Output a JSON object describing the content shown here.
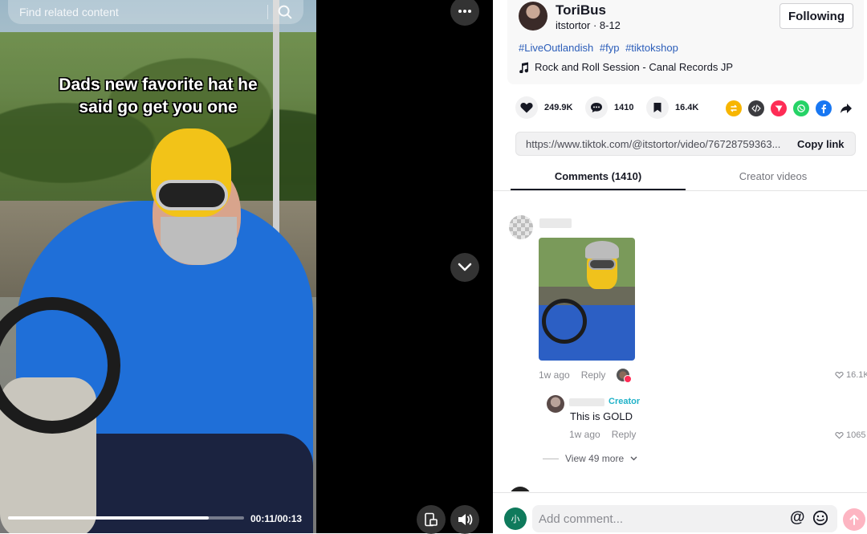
{
  "video": {
    "search_placeholder": "Find related content",
    "caption_line1": "Dads new favorite hat he",
    "caption_line2": "said go get you one",
    "timecode": "00:11/00:13",
    "progress": 0.85
  },
  "author": {
    "display_name": "ToriBus",
    "handle_date": "itstortor · 8-12",
    "follow_label": "Following",
    "hashtags": [
      "#LiveOutlandish",
      "#fyp",
      "#tiktokshop"
    ],
    "music": "Rock and Roll Session - Canal Records JP"
  },
  "stats": {
    "likes": "249.9K",
    "comments": "1410",
    "saves": "16.4K"
  },
  "share_icons": [
    {
      "name": "repost-icon",
      "color": "#f7b500"
    },
    {
      "name": "embed-icon",
      "color": "#3b3b3f"
    },
    {
      "name": "send-to-friends-icon",
      "color": "#fe2c55"
    },
    {
      "name": "whatsapp-icon",
      "color": "#25d366"
    },
    {
      "name": "facebook-icon",
      "color": "#1877f2"
    },
    {
      "name": "share-arrow-icon",
      "color": "#161823"
    }
  ],
  "link": {
    "url": "https://www.tiktok.com/@itstortor/video/76728759363...",
    "copy_label": "Copy link"
  },
  "tabs": {
    "comments": "Comments (1410)",
    "creator_videos": "Creator videos"
  },
  "comment": {
    "time": "1w ago",
    "reply_label": "Reply",
    "likes": "16.1K"
  },
  "reply": {
    "badge": "Creator",
    "text": "This is GOLD",
    "time": "1w ago",
    "reply_label": "Reply",
    "likes": "1065"
  },
  "view_more": "View 49 more",
  "composer": {
    "avatar_initial": "小",
    "placeholder": "Add comment...",
    "at_symbol": "@"
  },
  "colors": {
    "accent": "#fe2c55",
    "hashtag": "#2b5db9",
    "creator_badge": "#20b2c8"
  }
}
